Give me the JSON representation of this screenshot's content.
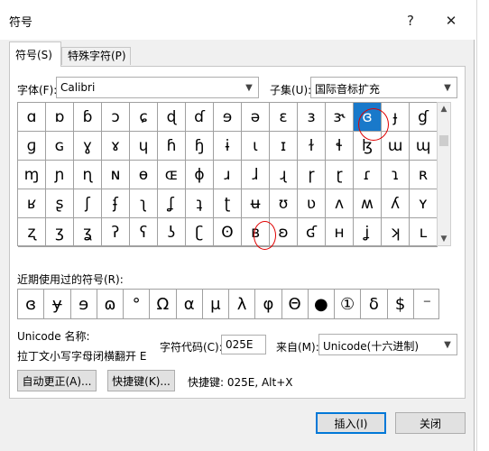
{
  "window": {
    "title": "符号",
    "help_label": "?",
    "close_label": "✕"
  },
  "tabs": [
    {
      "label": "符号(S)",
      "active": true
    },
    {
      "label": "特殊字符(P)",
      "active": false
    }
  ],
  "font": {
    "label": "字体(F):",
    "value": "Calibri"
  },
  "subset": {
    "label": "子集(U):",
    "value": "国际音标扩充"
  },
  "symbol_grid": {
    "rows": [
      [
        "ɑ",
        "ɒ",
        "ɓ",
        "ɔ",
        "ɕ",
        "ɖ",
        "ɗ",
        "ɘ",
        "ə",
        "ɛ",
        "ɜ",
        "ɝ",
        "ɞ",
        "ɟ",
        "ɠ"
      ],
      [
        "ɡ",
        "ɢ",
        "ɣ",
        "ɤ",
        "ɥ",
        "ɦ",
        "ɧ",
        "ɨ",
        "ɩ",
        "ɪ",
        "ɫ",
        "ɬ",
        "ɮ",
        "ɯ",
        "ɰ"
      ],
      [
        "ɱ",
        "ɲ",
        "ɳ",
        "ɴ",
        "ɵ",
        "ɶ",
        "ɸ",
        "ɹ",
        "ɺ",
        "ɻ",
        "ɼ",
        "ɽ",
        "ɾ",
        "ɿ",
        "ʀ"
      ],
      [
        "ʁ",
        "ʂ",
        "ʃ",
        "ʄ",
        "ʅ",
        "ʆ",
        "ʇ",
        "ʈ",
        "ʉ",
        "ʊ",
        "ʋ",
        "ʌ",
        "ʍ",
        "ʎ",
        "ʏ"
      ],
      [
        "ʐ",
        "ʒ",
        "ʓ",
        "ʔ",
        "ʕ",
        "ʖ",
        "ʗ",
        "ʘ",
        "ʙ",
        "ʚ",
        "ʛ",
        "ʜ",
        "ʝ",
        "ʞ",
        "ʟ"
      ]
    ],
    "selected": {
      "row": 0,
      "col": 12
    }
  },
  "recent": {
    "label": "近期使用过的符号(R):",
    "symbols": [
      "ɞ",
      "ɏ",
      "ɘ",
      "ɷ",
      "°",
      "Ω",
      "α",
      "μ",
      "λ",
      "φ",
      "Θ",
      "●",
      "①",
      "δ",
      "$",
      "⁻"
    ]
  },
  "unicode_name": {
    "label": "Unicode 名称:",
    "value": "拉丁文小写字母闭横翻开 E"
  },
  "char_code": {
    "label": "字符代码(C):",
    "value": "025E"
  },
  "from": {
    "label": "来自(M):",
    "value": "Unicode(十六进制)"
  },
  "buttons": {
    "autocorrect": "自动更正(A)...",
    "shortcut": "快捷键(K)...",
    "shortcut_info": "快捷键: 025E, Alt+X",
    "insert": "插入(I)",
    "close": "关闭"
  }
}
